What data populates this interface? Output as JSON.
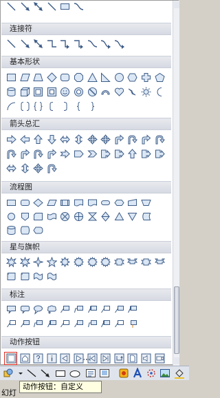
{
  "sections": [
    {
      "key": "connectors",
      "title": "连接符"
    },
    {
      "key": "basic",
      "title": "基本形状"
    },
    {
      "key": "arrows",
      "title": "箭头总汇"
    },
    {
      "key": "flowchart",
      "title": "流程图"
    },
    {
      "key": "stars",
      "title": "星与旗帜"
    },
    {
      "key": "callouts",
      "title": "标注"
    },
    {
      "key": "actions",
      "title": "动作按钮"
    }
  ],
  "tooltip": "动作按钮：自定义",
  "status": "幻灯",
  "colors": {
    "shape_fill": "#dbe7f5",
    "shape_stroke": "#3d5c87",
    "accent_red": "#e03030"
  }
}
